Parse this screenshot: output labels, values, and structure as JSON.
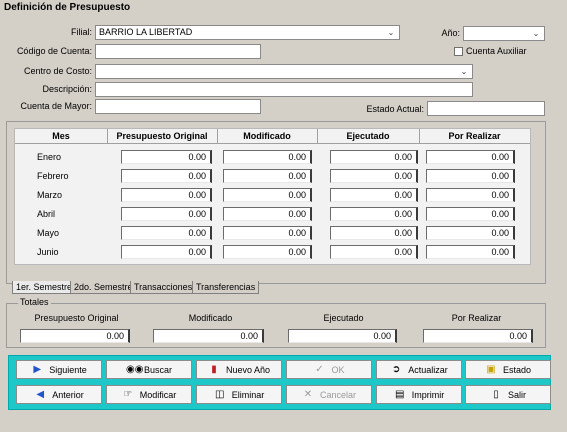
{
  "window": {
    "title": "Definición de Presupuesto"
  },
  "header": {
    "filial_label": "Filial:",
    "filial_value": "BARRIO LA LIBERTAD",
    "anio_label": "Año:",
    "anio_value": "",
    "cuenta_auxiliar_label": "Cuenta Auxiliar",
    "codigo_cuenta_label": "Código de Cuenta:",
    "codigo_cuenta_value": "",
    "centro_costo_label": "Centro de Costo:",
    "centro_costo_value": "",
    "descripcion_label": "Descripción:",
    "descripcion_value": "",
    "cuenta_mayor_label": "Cuenta de Mayor:",
    "cuenta_mayor_value": "",
    "estado_actual_label": "Estado Actual:",
    "estado_actual_value": ""
  },
  "grid": {
    "columns": [
      "Mes",
      "Presupuesto Original",
      "Modificado",
      "Ejecutado",
      "Por Realizar"
    ],
    "rows": [
      {
        "mes": "Enero",
        "original": "0.00",
        "modificado": "0.00",
        "ejecutado": "0.00",
        "por_realizar": "0.00"
      },
      {
        "mes": "Febrero",
        "original": "0.00",
        "modificado": "0.00",
        "ejecutado": "0.00",
        "por_realizar": "0.00"
      },
      {
        "mes": "Marzo",
        "original": "0.00",
        "modificado": "0.00",
        "ejecutado": "0.00",
        "por_realizar": "0.00"
      },
      {
        "mes": "Abril",
        "original": "0.00",
        "modificado": "0.00",
        "ejecutado": "0.00",
        "por_realizar": "0.00"
      },
      {
        "mes": "Mayo",
        "original": "0.00",
        "modificado": "0.00",
        "ejecutado": "0.00",
        "por_realizar": "0.00"
      },
      {
        "mes": "Junio",
        "original": "0.00",
        "modificado": "0.00",
        "ejecutado": "0.00",
        "por_realizar": "0.00"
      }
    ]
  },
  "tabs": [
    "1er. Semestre",
    "2do. Semestre",
    "Transacciones",
    "Transferencias"
  ],
  "totales": {
    "legend": "Totales",
    "headers": [
      "Presupuesto Original",
      "Modificado",
      "Ejecutado",
      "Por Realizar"
    ],
    "values": [
      "0.00",
      "0.00",
      "0.00",
      "0.00"
    ]
  },
  "buttons": {
    "siguiente": "Siguiente",
    "buscar": "Buscar",
    "nuevo_anio": "Nuevo Año",
    "ok": "OK",
    "actualizar": "Actualizar",
    "estado": "Estado",
    "anterior": "Anterior",
    "modificar": "Modificar",
    "eliminar": "Eliminar",
    "cancelar": "Cancelar",
    "imprimir": "Imprimir",
    "salir": "Salir"
  },
  "colors": {
    "window_bg": "#d4d0c8",
    "button_bar": "#1fc8c8"
  }
}
